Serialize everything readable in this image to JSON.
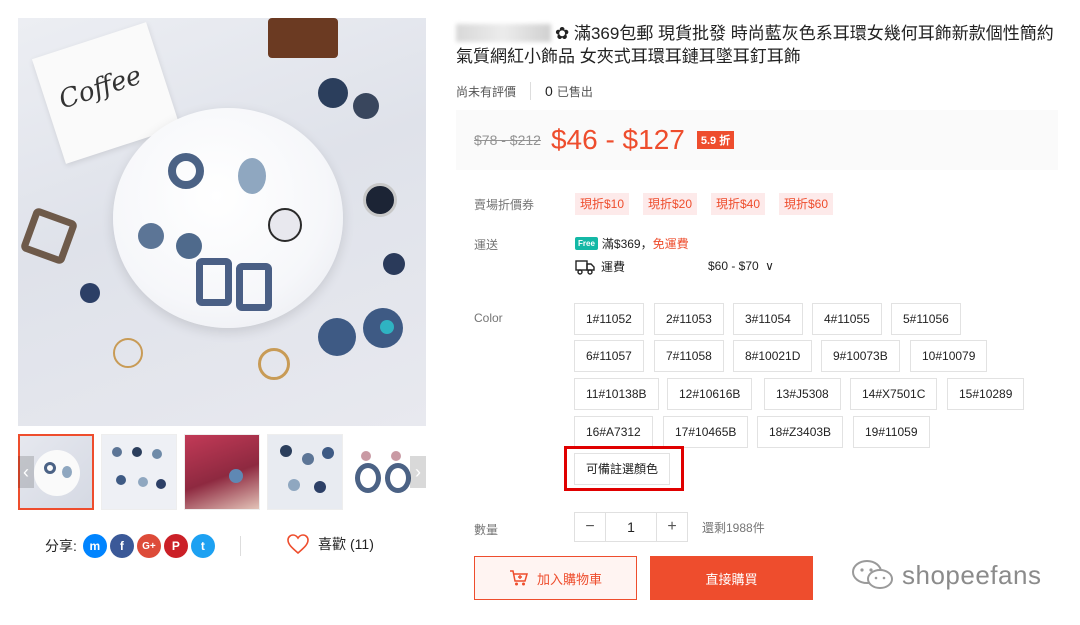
{
  "product": {
    "title_rest": "✿ 滿369包郵 現貨批發 時尚藍灰色系耳環女幾何耳飾新款個性簡約氣質網紅小飾品 女夾式耳環耳鏈耳墜耳釘耳飾",
    "card_text": "Coffee",
    "ratings_text": "尚未有評價",
    "sold_count": "0",
    "sold_label": "已售出"
  },
  "price": {
    "original": "$78 - $212",
    "current": "$46 - $127",
    "discount": "5.9 折"
  },
  "vouchers": {
    "label": "賣場折價券",
    "items": [
      "現折$10",
      "現折$20",
      "現折$40",
      "現折$60"
    ]
  },
  "shipping": {
    "label": "運送",
    "free_badge": "Free",
    "threshold": "滿$369，",
    "free_text": "免運費",
    "fee_label": "運費",
    "fee_value": "$60 - $70",
    "fee_chevron": "∨"
  },
  "color": {
    "label": "Color",
    "options": [
      "1#11052",
      "2#11053",
      "3#11054",
      "4#11055",
      "5#11056",
      "6#11057",
      "7#11058",
      "8#10021D",
      "9#10073B",
      "10#10079",
      "11#10138B",
      "12#10616B",
      "13#J5308",
      "14#X7501C",
      "15#10289",
      "16#A7312",
      "17#10465B",
      "18#Z3403B",
      "19#11059",
      "可備註選顏色"
    ]
  },
  "quantity": {
    "label": "數量",
    "minus": "−",
    "value": "1",
    "plus": "+",
    "stock": "還剩1988件"
  },
  "actions": {
    "add_to_cart": "加入購物車",
    "buy_now": "直接購買"
  },
  "share": {
    "label": "分享:",
    "messenger": "m",
    "facebook": "f",
    "google": "G+",
    "pinterest": "P",
    "twitter": "t"
  },
  "like": {
    "label": "喜歡",
    "count": "(11)"
  },
  "thumbnail_arrows": {
    "left": "‹",
    "right": "›"
  },
  "watermark": "shopeefans",
  "colors": {
    "accent": "#ee4d2d",
    "voucher_bg": "#fdeaea",
    "highlight_box": "#e00000"
  }
}
